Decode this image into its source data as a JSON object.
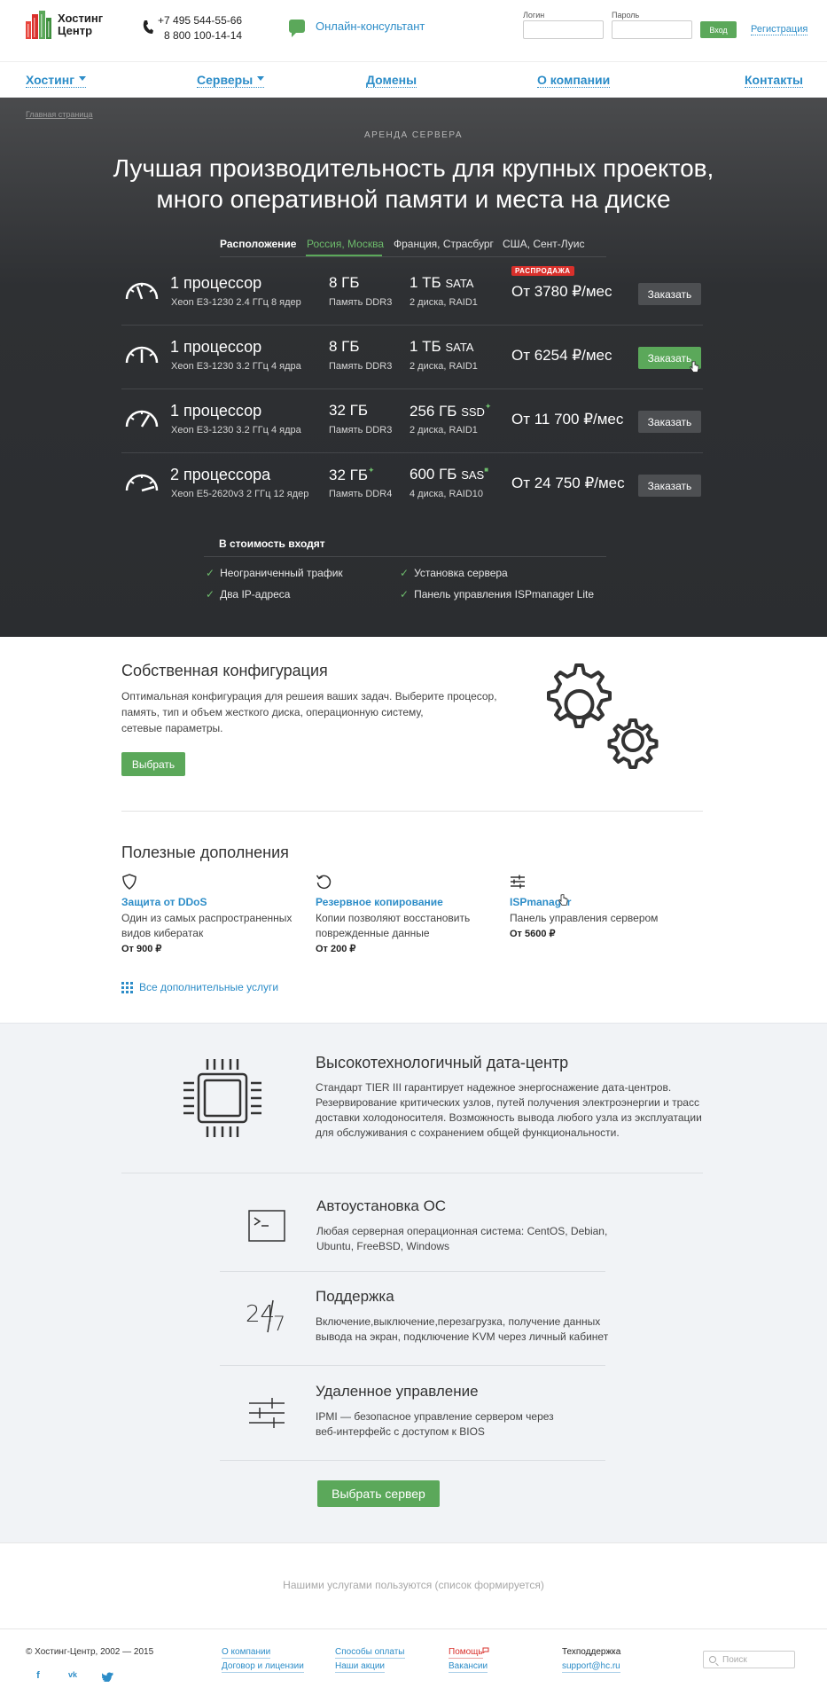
{
  "header": {
    "logo_line1": "Хостинг",
    "logo_line2": "Центр",
    "phone1": "+7 495 544-55-66",
    "phone2": "8 800 100-14-14",
    "consultant": "Онлайн-консультант",
    "login_label": "Логин",
    "password_label": "Пароль",
    "enter_button": "Вход",
    "register_link": "Регистрация"
  },
  "nav": {
    "items": [
      {
        "label": "Хостинг",
        "dropdown": true
      },
      {
        "label": "Серверы",
        "dropdown": true
      },
      {
        "label": "Домены",
        "dropdown": false
      },
      {
        "label": "О компании",
        "dropdown": false
      },
      {
        "label": "Контакты",
        "dropdown": false
      }
    ]
  },
  "hero": {
    "breadcrumb": "Главная страница",
    "kicker": "АРЕНДА СЕРВЕРА",
    "title_line1": "Лучшая производительность для крупных проектов,",
    "title_line2": "много оперативной памяти и места на диске",
    "location_label": "Расположение",
    "locations": [
      "Россия, Москва",
      "Франция, Страсбург",
      "США, Сент-Луис"
    ],
    "selected_location": "Россия, Москва",
    "sale_badge": "РАСПРОДАЖА",
    "order_label": "Заказать",
    "servers": [
      {
        "cpu": "1 процессор",
        "cpu_model": "Xeon E3-1230 2.4 ГГц 8 ядер",
        "ram": "8 ГБ",
        "ram_type": "Память DDR3",
        "disk": "1 ТБ",
        "disk_type": "SATA",
        "disk_info": "2 диска, RAID1",
        "price": "От 3780 ₽/мес",
        "sale": true,
        "hovered": false
      },
      {
        "cpu": "1 процессор",
        "cpu_model": "Xeon E3-1230 3.2 ГГц 4 ядра",
        "ram": "8 ГБ",
        "ram_type": "Память DDR3",
        "disk": "1 ТБ",
        "disk_type": "SATA",
        "disk_info": "2 диска, RAID1",
        "price": "От 6254 ₽/мес",
        "sale": false,
        "hovered": true
      },
      {
        "cpu": "1 процессор",
        "cpu_model": "Xeon E3-1230 3.2 ГГц 4 ядра",
        "ram": "32 ГБ",
        "ram_type": "Память DDR3",
        "disk": "256 ГБ",
        "disk_type": "SSD",
        "disk_info": "2 диска, RAID1",
        "price": "От 11 700 ₽/мес",
        "sale": false,
        "hovered": false
      },
      {
        "cpu": "2 процессора",
        "cpu_model": "Xeon E5-2620v3 2 ГГц 12 ядер",
        "ram": "32 ГБ",
        "ram_type": "Память DDR4",
        "disk": "600 ГБ",
        "disk_type": "SAS",
        "disk_info": "4 диска, RAID10",
        "price": "От 24 750 ₽/мес",
        "sale": false,
        "hovered": false
      }
    ],
    "included_title": "В стоимость входят",
    "included": [
      "Неограниченный трафик",
      "Установка сервера",
      "Два IP-адреса",
      "Панель управления ISPmanager Lite"
    ]
  },
  "custom": {
    "title": "Собственная конфигурация",
    "text_line1": "Оптимальная конфигурация для решеия ваших задач. Выберите процесор,",
    "text_line2": "память, тип и объем жесткого диска, операционную систему,",
    "text_line3": "сетевые параметры.",
    "button": "Выбрать"
  },
  "addons": {
    "title": "Полезные дополнения",
    "items": [
      {
        "name": "Защита от DDoS",
        "desc_line1": "Один из самых распространенных",
        "desc_line2": "видов кибератак",
        "price": "От 900 ₽",
        "icon": "shield-icon"
      },
      {
        "name": "Резервное копирование",
        "desc_line1": "Копии позволяют восстановить",
        "desc_line2": "поврежденные данные",
        "price": "От 200 ₽",
        "icon": "backup-icon"
      },
      {
        "name": "ISPmanager",
        "desc_line1": "Панель управления сервером",
        "desc_line2": "",
        "price": "От 5600 ₽",
        "icon": "settings-sliders-icon"
      }
    ],
    "all_link": "Все дополнительные услуги"
  },
  "datacenter": {
    "title": "Высокотехнологичный дата-центр",
    "text_line1": "Стандарт TIER III гарантирует надежное энергоснажение дата-центров.",
    "text_line2": "Резервирование критических узлов, путей получения электроэнергии и трасс",
    "text_line3": "доставки холодоносителя. Возможность вывода любого узла из эксплуатации",
    "text_line4": "для обслуживания с сохранением общей функциональности.",
    "features": [
      {
        "title": "Автоустановка ОС",
        "line1": "Любая серверная операционная система: CentOS, Debian,",
        "line2": "Ubuntu, FreeBSD, Windows",
        "icon": "terminal-icon"
      },
      {
        "title": "Поддержка",
        "line1": "Включение,выключение,перезагрузка, получение данных",
        "line2": "вывода на экран, подключение KVM через личный кабинет",
        "icon": "support-24-7-icon"
      },
      {
        "title": "Удаленное управление",
        "line1": "IPMI — безопасное управление сервером через",
        "line2": "веб-интерфейс с доступом к BIOS",
        "icon": "remote-control-icon"
      }
    ],
    "button": "Выбрать сервер"
  },
  "clients": {
    "text": "Нашими услугами пользуются (список формируется)"
  },
  "footer": {
    "copyright": "© Хостинг-Центр, 2002 — 2015",
    "col1": [
      "О компании",
      "Договор и лицензии"
    ],
    "col2": [
      "Способы оплаты",
      "Наши акции"
    ],
    "col3": [
      "Помощь",
      "Вакансии"
    ],
    "support_title": "Техподдержка",
    "support_email": "support@hc.ru",
    "search_placeholder": "Поиск",
    "social": [
      "f",
      "vk",
      "tw"
    ]
  },
  "colors": {
    "accent": "#5ba85a",
    "link": "#2d8dc8",
    "sale": "#d9302b",
    "hero_bg": "#2e3033"
  }
}
